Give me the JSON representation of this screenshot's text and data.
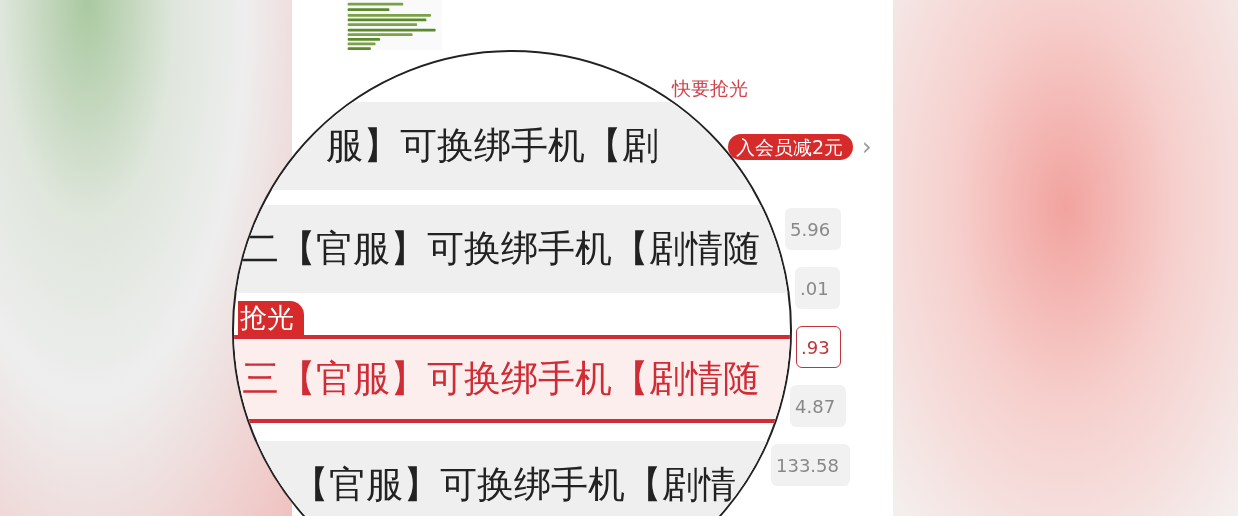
{
  "stock_tag": "快要抢光",
  "member_badge": {
    "text": "入会员减2元",
    "chevron": "›"
  },
  "prices": [
    {
      "text": "5.96",
      "selected": false
    },
    {
      "text": ".01",
      "selected": false
    },
    {
      "text": ".93",
      "selected": true
    },
    {
      "text": "4.87",
      "selected": false
    },
    {
      "text": "133.58",
      "selected": false
    }
  ],
  "magnifier": {
    "rows": [
      {
        "text": "服】可换绑手机【剧",
        "selected": false
      },
      {
        "text": "二【官服】可换绑手机【剧情随",
        "selected": false
      },
      {
        "tag": "抢光",
        "text": "三【官服】可换绑手机【剧情随",
        "selected": true
      },
      {
        "text": "【官服】可换绑手机【剧情",
        "selected": false
      }
    ]
  }
}
